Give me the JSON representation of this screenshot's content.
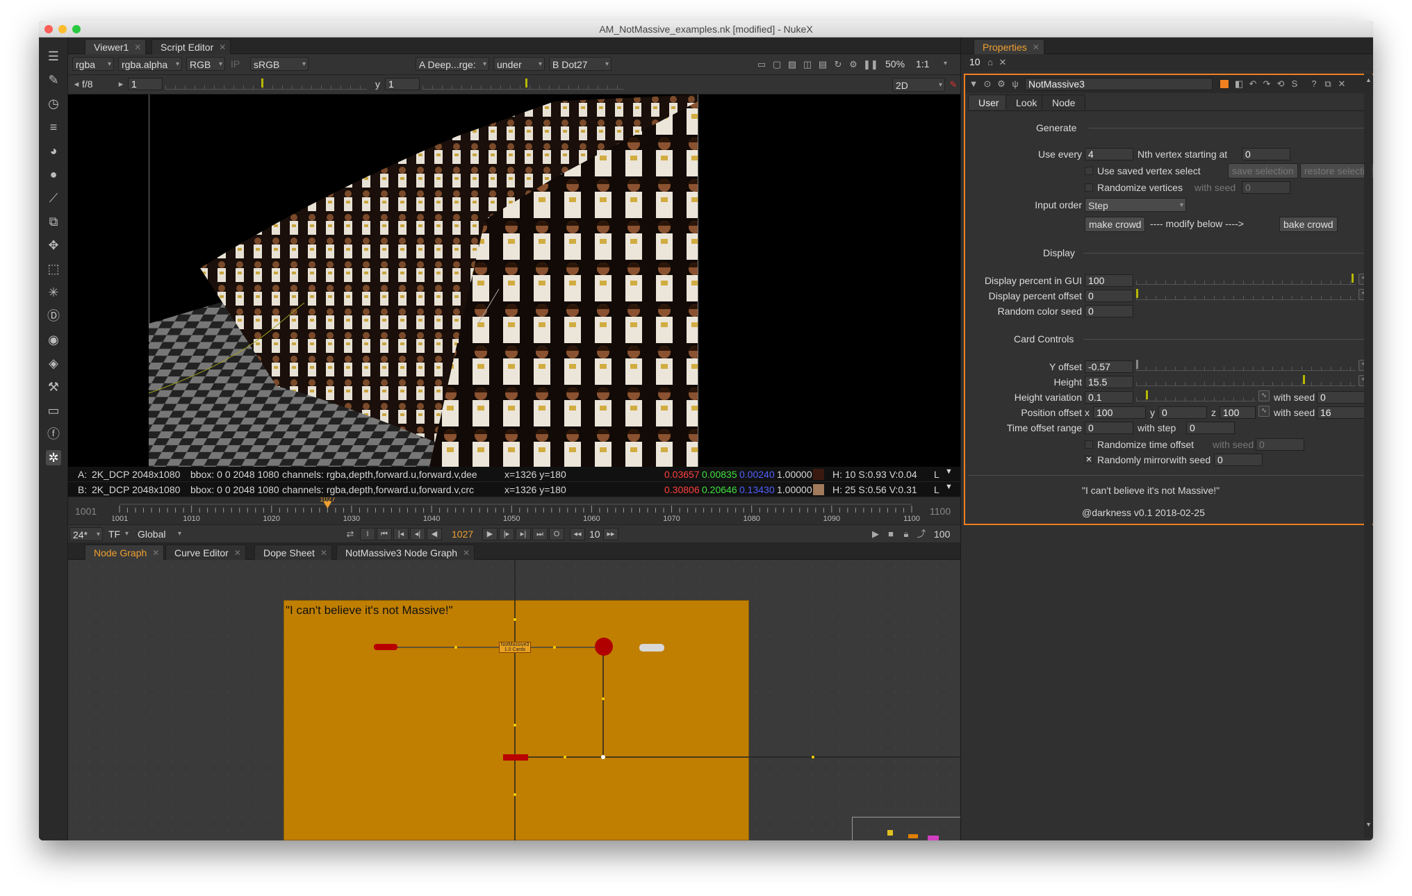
{
  "window": {
    "title": "AM_NotMassive_examples.nk [modified] - NukeX"
  },
  "viewer_tabs": [
    {
      "label": "Viewer1"
    },
    {
      "label": "Script Editor"
    }
  ],
  "viewer_controls": {
    "channels": "rgba",
    "alpha": "rgba.alpha",
    "display": "RGB",
    "ip": "IP",
    "lut": "sRGB",
    "input_a": "A  Deep...rge:",
    "merge_op": "under",
    "input_b": "B  Dot27",
    "zoom": "50%",
    "ratio": "1:1",
    "fstop": "f/8",
    "gain": "1",
    "gamma_label": "y",
    "gamma": "1",
    "view_mode": "2D"
  },
  "pixel_info": {
    "a": {
      "prefix": "A:",
      "format": "2K_DCP 2048x1080",
      "bbox": "bbox: 0 0 2048 1080",
      "channels": "channels: rgba,depth,forward.u,forward.v,dee",
      "coords": "x=1326 y=180",
      "r": "0.03657",
      "g": "0.00835",
      "b": "0.00240",
      "a": "1.00000",
      "hsv": "H: 10 S:0.93 V:0.04",
      "l": "L",
      "swatch": "#3a1a10"
    },
    "b": {
      "prefix": "B:",
      "format": "2K_DCP 2048x1080",
      "bbox": "bbox: 0 0 2048 1080",
      "channels": "channels: rgba,depth,forward.u,forward.v,crc",
      "coords": "x=1326 y=180",
      "r": "0.30806",
      "g": "0.20646",
      "b": "0.13430",
      "a": "1.00000",
      "hsv": "H: 25 S:0.56 V:0.31",
      "l": "L",
      "swatch": "#a07a5a"
    }
  },
  "timeline": {
    "start": "1001",
    "end": "1100",
    "current": "1027",
    "ticks": [
      "1001",
      "1010",
      "1020",
      "1030",
      "1040",
      "1050",
      "1060",
      "1070",
      "1080",
      "1090",
      "1100"
    ],
    "fps": "24*",
    "tf": "TF",
    "global": "Global",
    "frame": "1027",
    "step": "10",
    "last": "100"
  },
  "graph_tabs": [
    {
      "label": "Node Graph"
    },
    {
      "label": "Curve Editor"
    },
    {
      "label": "Dope Sheet"
    },
    {
      "label": "NotMassive3 Node Graph"
    }
  ],
  "backdrop": {
    "label": "\"I can't believe it's not Massive!\"",
    "color": "#c07f00"
  },
  "node_label": "NotMassive3 1.0 Cards",
  "properties": {
    "tab": "Properties",
    "max_panels": "10",
    "node_name": "NotMassive3",
    "tabs": [
      "User",
      "Look",
      "Node"
    ],
    "generate": {
      "header": "Generate",
      "use_every_label": "Use every",
      "use_every": "4",
      "nth_label": "Nth vertex starting at",
      "nth": "0",
      "saved_select_label": "Use saved vertex select",
      "save_sel": "save selection",
      "restore_sel": "restore selection",
      "randomize_label": "Randomize vertices",
      "with_seed_label": "with seed",
      "rand_seed": "0",
      "input_order_label": "Input order",
      "input_order": "Step",
      "make_crowd": "make crowd",
      "modify_text": "---- modify below ---->",
      "bake_crowd": "bake crowd"
    },
    "display": {
      "header": "Display",
      "pct_gui_label": "Display percent in GUI",
      "pct_gui": "100",
      "pct_offset_label": "Display percent offset",
      "pct_offset": "0",
      "color_seed_label": "Random color seed",
      "color_seed": "0"
    },
    "card": {
      "header": "Card Controls",
      "y_offset_label": "Y offset",
      "y_offset": "-0.57",
      "height_label": "Height",
      "height": "15.5",
      "height_var_label": "Height variation",
      "height_var": "0.1",
      "hv_seed_label": "with seed",
      "hv_seed": "0",
      "pos_offset_label": "Position offset",
      "x_label": "x",
      "pos_x": "100",
      "y_label": "y",
      "pos_y": "0",
      "z_label": "z",
      "pos_z": "100",
      "pos_seed_label": "with seed",
      "pos_seed": "16",
      "time_range_label": "Time offset range",
      "time_range": "0",
      "step_label": "with step",
      "time_step": "0",
      "rand_time_label": "Randomize time offset",
      "rt_seed_label": "with seed",
      "rt_seed": "0",
      "mirror_label": "Randomly mirror",
      "mirror_seed_label": "with seed",
      "mirror_seed": "0"
    },
    "footer_quote": "\"I can't believe it's not Massive!\"",
    "footer_credit": "@darkness v0.1 2018-02-25"
  },
  "accent_color": "#f0a030"
}
